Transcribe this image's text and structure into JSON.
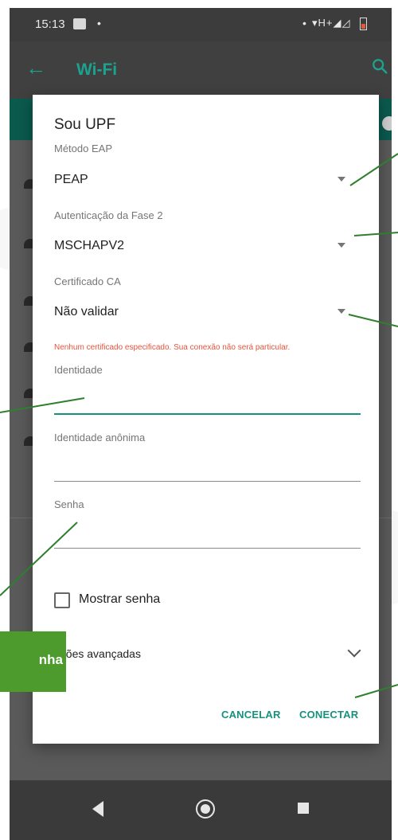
{
  "status_bar": {
    "time": "15:13",
    "network_label": "H+",
    "battery_color": "#e05a3a"
  },
  "app_bar": {
    "title": "Wi-Fi",
    "accent_color": "#1ba38f"
  },
  "dialog": {
    "title": "Sou UPF",
    "eap_method": {
      "label": "Método EAP",
      "value": "PEAP"
    },
    "phase2_auth": {
      "label": "Autenticação da Fase 2",
      "value": "MSCHAPV2"
    },
    "ca_certificate": {
      "label": "Certificado CA",
      "value": "Não validar"
    },
    "warning": "Nenhum certificado especificado. Sua conexão não será particular.",
    "identity": {
      "label": "Identidade",
      "value": ""
    },
    "anonymous_identity": {
      "label": "Identidade anônima",
      "value": ""
    },
    "password": {
      "label": "Senha",
      "value": ""
    },
    "show_password": {
      "label": "Mostrar senha",
      "checked": false
    },
    "advanced_options": {
      "label": "pções avançadas"
    },
    "buttons": {
      "cancel": "CANCELAR",
      "connect": "CONECTAR"
    }
  },
  "annotation": {
    "callout_text": "nha",
    "callout_color": "#4d9b2c",
    "line_color": "#2f7f2f"
  },
  "icons": {
    "back": "arrow-left-icon",
    "search": "search-icon",
    "dropdown": "caret-down-icon",
    "chevron": "chevron-down-icon",
    "nav_back": "triangle-back-icon",
    "nav_home": "circle-home-icon",
    "nav_recents": "square-recents-icon"
  }
}
